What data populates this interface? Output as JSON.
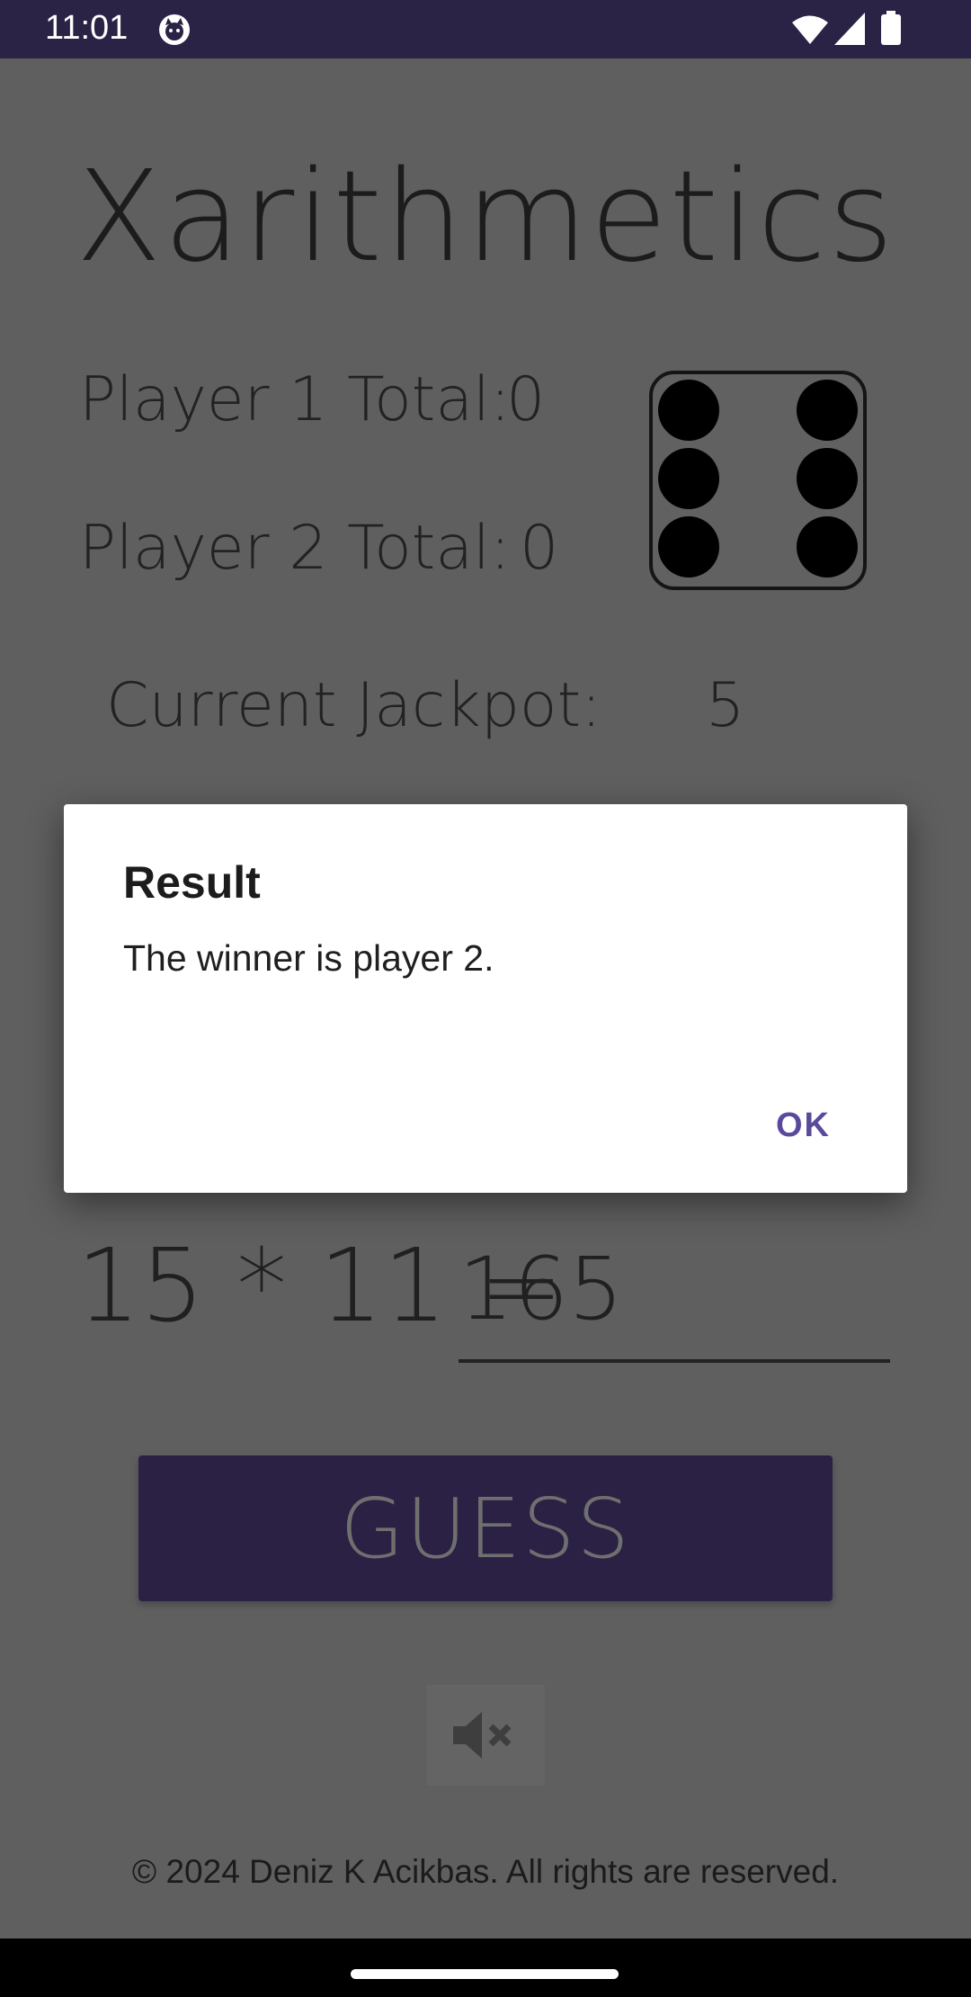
{
  "status_bar": {
    "time": "11:01",
    "icons": [
      "app-notification-icon",
      "wifi-icon",
      "signal-icon",
      "battery-icon"
    ]
  },
  "app": {
    "title": "Xarithmetics",
    "player1_label": "Player 1 Total:",
    "player1_value": "0",
    "player2_label": "Player 2 Total:",
    "player2_value": "0",
    "die_face": 6,
    "jackpot_label": "Current Jackpot:",
    "jackpot_value": "5",
    "equation": "15 * 11 =",
    "answer_value": "165",
    "guess_label": "GUESS",
    "mute_icon": "volume-mute-icon",
    "copyright": "© 2024 Deniz K Acikbas. All rights are reserved."
  },
  "dialog": {
    "title": "Result",
    "message": "The winner is player 2.",
    "ok_label": "OK"
  },
  "colors": {
    "status_bar": "#2b2345",
    "button": "#2b2145",
    "accent": "#5b4a9b"
  }
}
